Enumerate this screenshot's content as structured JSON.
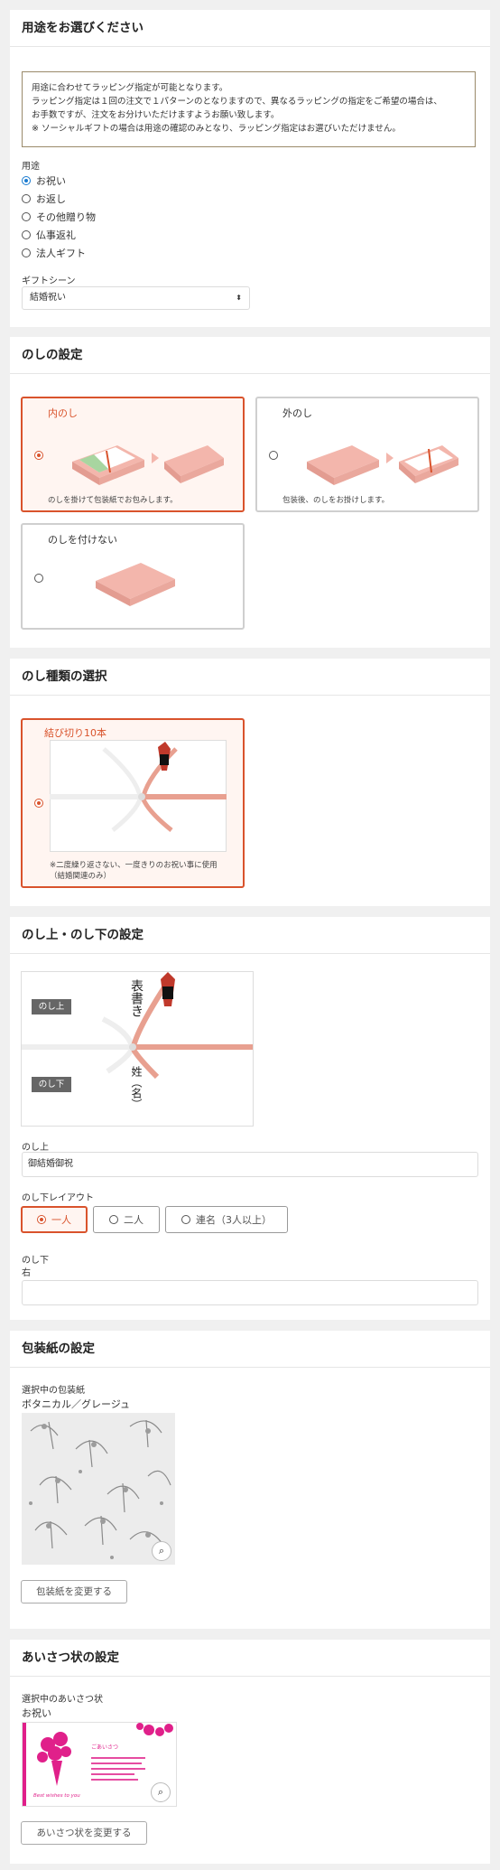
{
  "usage": {
    "title": "用途をお選びください",
    "notice": [
      "用途に合わせてラッピング指定が可能となります。",
      "ラッピング指定は１回の注文で１パターンのとなりますので、異なるラッピングの指定をご希望の場合は、",
      "お手数ですが、注文をお分けいただけますようお願い致します。",
      "※ ソーシャルギフトの場合は用途の確認のみとなり、ラッピング指定はお選びいただけません。"
    ],
    "label": "用途",
    "options": [
      "お祝い",
      "お返し",
      "その他贈り物",
      "仏事返礼",
      "法人ギフト"
    ],
    "selected": "お祝い",
    "scene_label": "ギフトシーン",
    "scene_value": "結婚祝い",
    "scene_arrow": "⬍"
  },
  "noshi_setting": {
    "title": "のしの設定",
    "cards": [
      {
        "title": "内のし",
        "desc": "のしを掛けて包装紙でお包みします。"
      },
      {
        "title": "外のし",
        "desc": "包装後、のしをお掛けします。"
      },
      {
        "title": "のしを付けない",
        "desc": ""
      }
    ],
    "selected": "内のし"
  },
  "noshi_type": {
    "title": "のし種類の選択",
    "card_title": "結び切り10本",
    "card_desc": [
      "※二度繰り返さない、一度きりのお祝い事に使用",
      "（結婚関連のみ）"
    ]
  },
  "noshi_text": {
    "title": "のし上・のし下の設定",
    "tag_upper": "のし上",
    "tag_lower": "のし下",
    "preview_upper": "表書き",
    "preview_lower": "姓（名）",
    "upper_label": "のし上",
    "upper_value": "御結婚御祝",
    "layout_label": "のし下レイアウト",
    "layouts": [
      "一人",
      "二人",
      "連名（3人以上）"
    ],
    "lower_label": "のし下",
    "lower_sub": "右",
    "lower_value": ""
  },
  "wrapping": {
    "title": "包装紙の設定",
    "selected_label": "選択中の包装紙",
    "selected_name": "ボタニカル／グレージュ",
    "button": "包装紙を変更する",
    "zoom_icon": "search-icon"
  },
  "greeting": {
    "title": "あいさつ状の設定",
    "selected_label": "選択中のあいさつ状",
    "selected_name": "お祝い",
    "button": "あいさつ状を変更する",
    "card_caption": "Best wishes to you",
    "card_heading": "ごあいさつ"
  },
  "colors": {
    "accent": "#d9532c",
    "radio_blue": "#1a7bd0",
    "noshi_pink": "#f3b6ac"
  }
}
